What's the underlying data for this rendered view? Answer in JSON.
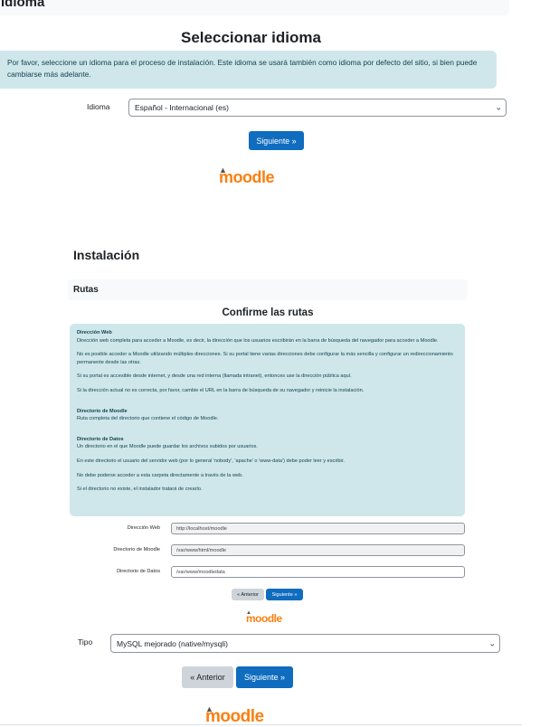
{
  "header": {
    "title": "Idioma"
  },
  "lang_page": {
    "heading": "Seleccionar idioma",
    "info": "Por favor, seleccione un idioma para el proceso de instalación. Este idioma se usará también como idioma por defecto del sitio, si bien puede cambiarse más adelante.",
    "language_label": "Idioma",
    "language_value": "Español - Internacional (es)",
    "next_label": "Siguiente »"
  },
  "logo": {
    "text": "moodle"
  },
  "install": {
    "heading": "Instalación",
    "section": "Rutas",
    "confirm_heading": "Confirme las rutas",
    "info": {
      "web_title": "Dirección Web",
      "web_desc": "Dirección web completa para acceder a Moodle, es decir, la dirección que los usuarios escribirán en la barra de búsqueda del navegador para acceder a Moodle.",
      "web_multi": "No es posible acceder a Moodle utilizando múltiples direcciones. Si su portal tiene varias direcciones debe configurar la más sencilla y configurar un redireccionamiento permanente desde las otras.",
      "web_intranet": "Si su portal es accesible desde internet, y desde una red interna (llamada intranet), entonces use la dirección pública aquí.",
      "web_wrong": "Si la dirección actual no es correcta, por favor, cambie el URL en la barra de búsqueda de su navegador y reinicie la instalación.",
      "dir_title": "Directorio de Moodle",
      "dir_desc": "Ruta completa del directorio que contiene el código de Moodle.",
      "data_title": "Directorio de Datos",
      "data_desc": "Un directorio en el que Moodle puede guardar los archivos subidos por usuarios.",
      "data_perm": "En este directorio el usuario del servidor web (por lo general 'nobody', 'apache' o 'www-data') debe poder leer y escribir.",
      "data_web": "No debe poderse acceder a esta carpeta directamente a través de la web.",
      "data_create": "Si el directorio no existe, el instalador tratará de crearlo."
    },
    "fields": [
      {
        "label": "Dirección Web",
        "value": "http://localhost/moodle"
      },
      {
        "label": "Directorio de Moodle",
        "value": "/var/www/html/moodle"
      },
      {
        "label": "Directorio de Datos",
        "value": "/var/www/moodledata"
      }
    ],
    "prev_label": "« Anterior",
    "next_label": "Siguiente »"
  },
  "db_page": {
    "type_label": "Tipo",
    "type_value": "MySQL mejorado (native/mysqli)",
    "prev_label": "« Anterior",
    "next_label": "Siguiente »"
  },
  "colors": {
    "primary": "#0f6cbf",
    "info_bg": "#cfe7ea",
    "moodle_orange": "#f98012"
  }
}
